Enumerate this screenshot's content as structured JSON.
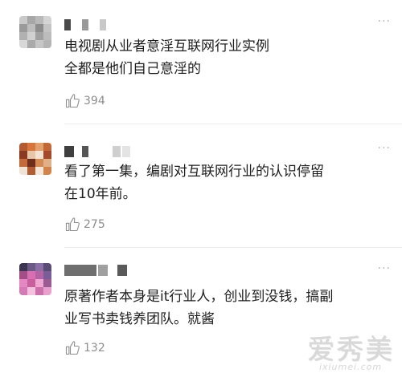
{
  "comments": [
    {
      "text_line1": "电视剧从业者意淫互联网行业实例",
      "text_line2": "全都是他们自己意淫的",
      "likes": "394",
      "more": "···"
    },
    {
      "text_line1": "看了第一集，编剧对互联网行业的认识停留",
      "text_line2": "在10年前。",
      "likes": "275",
      "more": "···"
    },
    {
      "text_line1": "原著作者本身是it行业人，创业到没钱，搞副",
      "text_line2": "业写书卖钱养团队。就酱",
      "likes": "132",
      "more": "···"
    }
  ],
  "icons": {
    "like": "thumbs-up-icon",
    "more": "more-icon"
  },
  "watermark": {
    "cn": "爱秀美",
    "url": "ixiumei.com"
  }
}
